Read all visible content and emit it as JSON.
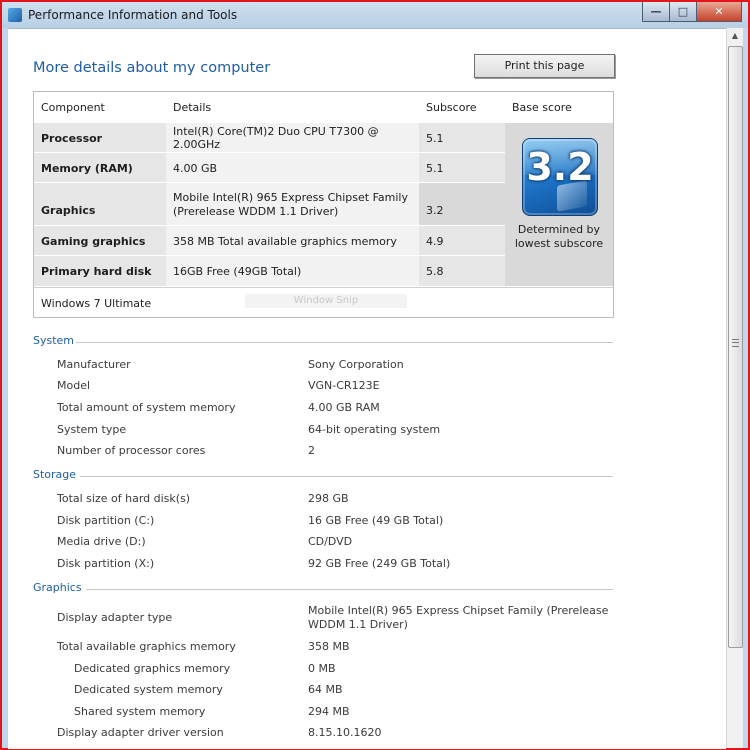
{
  "window": {
    "title": "Performance Information and Tools",
    "buttons": {
      "minimize": "—",
      "maximize": "□",
      "close": "✕"
    }
  },
  "header": {
    "title": "More details about my computer",
    "print_label": "Print this page"
  },
  "score_table": {
    "columns": [
      "Component",
      "Details",
      "Subscore",
      "Base score"
    ],
    "rows": [
      {
        "component": "Processor",
        "details": "Intel(R) Core(TM)2 Duo CPU T7300 @ 2.00GHz",
        "subscore": "5.1"
      },
      {
        "component": "Memory (RAM)",
        "details": "4.00 GB",
        "subscore": "5.1"
      },
      {
        "component": "Graphics",
        "details_line1": "Mobile Intel(R) 965 Express Chipset Family",
        "details_line2": "(Prerelease WDDM 1.1 Driver)",
        "subscore": "3.2"
      },
      {
        "component": "Gaming graphics",
        "details": "358 MB Total available graphics memory",
        "subscore": "4.9"
      },
      {
        "component": "Primary hard disk",
        "details": "16GB Free (49GB Total)",
        "subscore": "5.8"
      }
    ],
    "base_score": "3.2",
    "base_caption_line1": "Determined by",
    "base_caption_line2": "lowest subscore",
    "os": "Windows 7 Ultimate",
    "snip_ghost": "Window Snip"
  },
  "system": {
    "heading": "System",
    "items": [
      {
        "label": "Manufacturer",
        "value": "Sony Corporation"
      },
      {
        "label": "Model",
        "value": "VGN-CR123E"
      },
      {
        "label": "Total amount of system memory",
        "value": "4.00 GB RAM"
      },
      {
        "label": "System type",
        "value": "64-bit operating system"
      },
      {
        "label": "Number of processor cores",
        "value": "2"
      }
    ]
  },
  "storage": {
    "heading": "Storage",
    "items": [
      {
        "label": "Total size of hard disk(s)",
        "value": "298 GB"
      },
      {
        "label": "Disk partition (C:)",
        "value": "16 GB Free (49 GB Total)"
      },
      {
        "label": "Media drive (D:)",
        "value": "CD/DVD"
      },
      {
        "label": "Disk partition (X:)",
        "value": "92 GB Free (249 GB Total)"
      }
    ]
  },
  "graphics": {
    "heading": "Graphics",
    "items": [
      {
        "label": "Display adapter type",
        "value_line1": "Mobile Intel(R) 965 Express Chipset Family (Prerelease",
        "value_line2": "WDDM 1.1 Driver)"
      },
      {
        "label": "Total available graphics memory",
        "value": "358 MB"
      },
      {
        "label": "Dedicated graphics memory",
        "value": "0 MB"
      },
      {
        "label": "Dedicated system memory",
        "value": "64 MB"
      },
      {
        "label": "Shared system memory",
        "value": "294 MB"
      },
      {
        "label": "Display adapter driver version",
        "value": "8.15.10.1620"
      }
    ]
  }
}
